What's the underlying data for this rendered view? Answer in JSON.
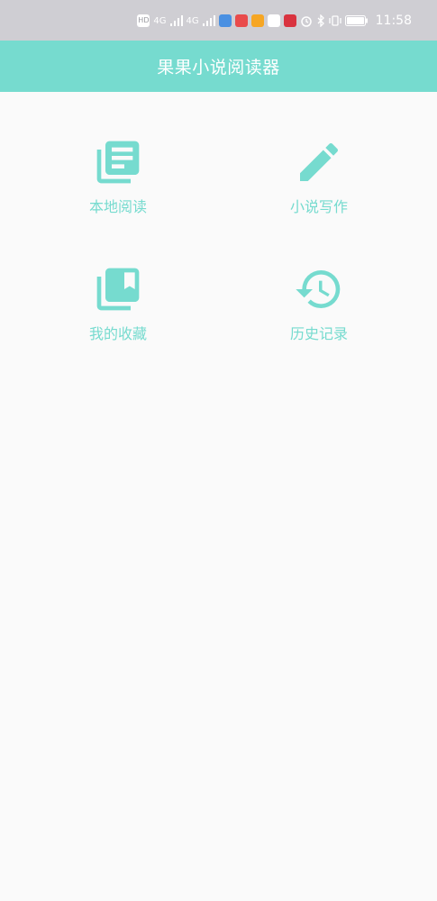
{
  "status_bar": {
    "time": "11:58",
    "left_badges": [
      "HD",
      "4G",
      "4G"
    ],
    "icons": [
      "alarm-icon",
      "bluetooth-icon",
      "vibrate-icon",
      "battery-icon"
    ]
  },
  "app_bar": {
    "title": "果果小说阅读器"
  },
  "menu": {
    "items": [
      {
        "label": "本地阅读",
        "icon": "library-books-icon"
      },
      {
        "label": "小说写作",
        "icon": "pencil-icon"
      },
      {
        "label": "我的收藏",
        "icon": "collections-bookmark-icon"
      },
      {
        "label": "历史记录",
        "icon": "history-icon"
      }
    ]
  },
  "colors": {
    "accent": "#76dbcf",
    "status_bar_bg": "#cfced3",
    "background": "#fafafa"
  }
}
